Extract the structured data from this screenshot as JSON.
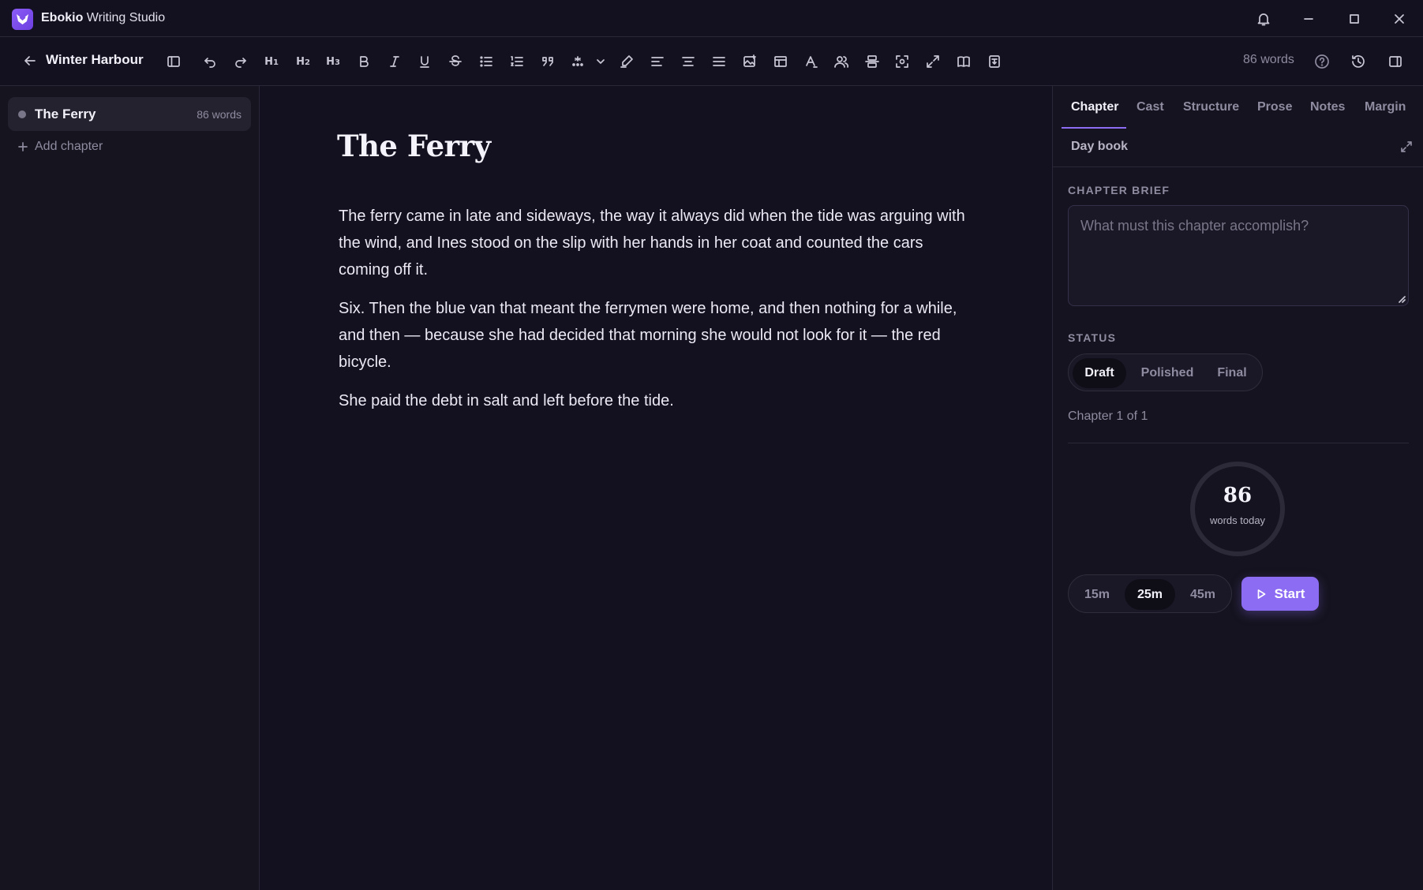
{
  "app": {
    "brand": "Ebokio",
    "name": "Writing Studio"
  },
  "toolbar": {
    "doc_title": "Winter Harbour",
    "word_count": "86 words",
    "h1": "H",
    "h1_sub": "1",
    "h2": "H",
    "h2_sub": "2",
    "h3": "H",
    "h3_sub": "3"
  },
  "sidebar": {
    "chapters": [
      {
        "name": "The Ferry",
        "words": "86 words"
      }
    ],
    "add_chapter": "Add chapter"
  },
  "editor": {
    "title": "The Ferry",
    "paragraphs": [
      "The ferry came in late and sideways, the way it always did when the tide was arguing with the wind, and Ines stood on the slip with her hands in her coat and counted the cars coming off it.",
      "Six. Then the blue van that meant the ferrymen were home, and then nothing for a while, and then — because she had decided that morning she would not look for it — the red bicycle.",
      "She paid the debt in salt and left before the tide."
    ]
  },
  "panel": {
    "tabs": [
      "Chapter",
      "Cast",
      "Structure",
      "Prose",
      "Notes",
      "Margin"
    ],
    "active_tab": "Chapter",
    "subtab": "Day book",
    "brief_label": "CHAPTER BRIEF",
    "brief_placeholder": "What must this chapter accomplish?",
    "status_label": "STATUS",
    "status_options": [
      "Draft",
      "Polished",
      "Final"
    ],
    "status_selected": "Draft",
    "chapter_of": "Chapter 1 of 1",
    "words_today": "86",
    "words_today_label": "words today",
    "timer_options": [
      "15m",
      "25m",
      "45m"
    ],
    "timer_selected": "25m",
    "start_label": "Start"
  },
  "colors": {
    "accent": "#8b6cf2",
    "background": "#13111f"
  }
}
